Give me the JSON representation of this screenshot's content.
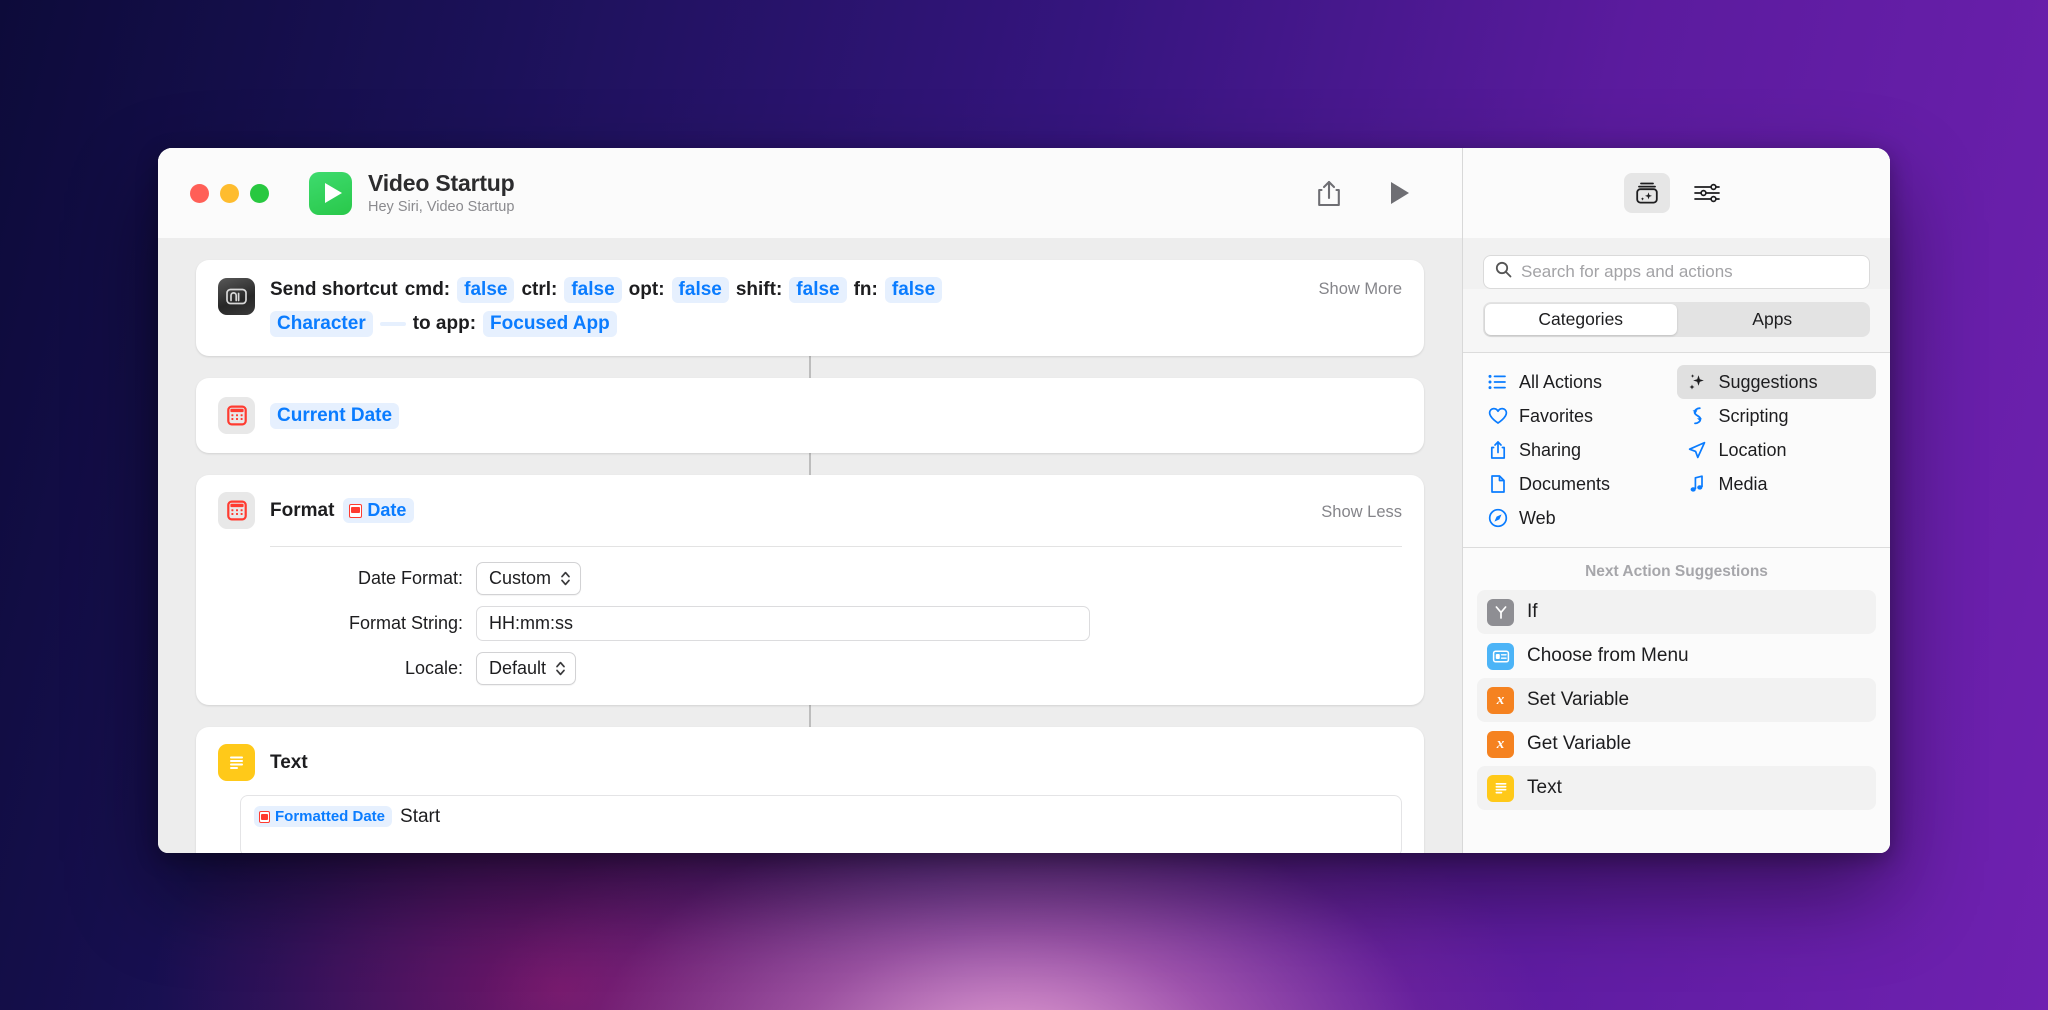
{
  "window": {
    "title": "Video Startup",
    "subtitle": "Hey Siri, Video Startup",
    "traffic_lights": {
      "close": "close",
      "minimize": "minimize",
      "zoom": "zoom"
    },
    "toolbar": {
      "share": "share-icon",
      "run": "play-icon"
    },
    "accent_blue": "#0a7cff",
    "app_icon_color": "#29c84a"
  },
  "flow": {
    "actions": [
      {
        "id": "send-shortcut",
        "icon": "keyboard-icon",
        "prefix": "Send shortcut",
        "toggle_label": "Show More",
        "parts": [
          {
            "kind": "label",
            "text": "cmd:"
          },
          {
            "kind": "token",
            "text": "false"
          },
          {
            "kind": "label",
            "text": "ctrl:"
          },
          {
            "kind": "token",
            "text": "false"
          },
          {
            "kind": "label",
            "text": "opt:"
          },
          {
            "kind": "token",
            "text": "false"
          },
          {
            "kind": "label",
            "text": "shift:"
          },
          {
            "kind": "token",
            "text": "false"
          },
          {
            "kind": "label",
            "text": "fn:"
          },
          {
            "kind": "token",
            "text": "false"
          },
          {
            "kind": "token",
            "text": "Character"
          },
          {
            "kind": "token-empty",
            "text": ""
          },
          {
            "kind": "label",
            "text": "to app:"
          },
          {
            "kind": "token",
            "text": "Focused App"
          }
        ]
      },
      {
        "id": "current-date",
        "icon": "calendar-icon",
        "token": "Current Date"
      },
      {
        "id": "format-date",
        "icon": "calendar-icon",
        "title": "Format",
        "token": "Date",
        "toggle_label": "Show Less",
        "fields": [
          {
            "label": "Date Format:",
            "type": "select",
            "value": "Custom"
          },
          {
            "label": "Format String:",
            "type": "input",
            "value": "HH:mm:ss"
          },
          {
            "label": "Locale:",
            "type": "select",
            "value": "Default"
          }
        ]
      },
      {
        "id": "text",
        "icon": "text-icon",
        "title": "Text",
        "body_token": "Formatted Date",
        "body_text": "Start"
      }
    ]
  },
  "sidebar": {
    "top_buttons": [
      {
        "name": "action-library-icon",
        "active": true
      },
      {
        "name": "sliders-icon",
        "active": false
      }
    ],
    "search": {
      "placeholder": "Search for apps and actions",
      "value": "",
      "icon": "search-icon"
    },
    "segments": [
      {
        "label": "Categories",
        "active": true
      },
      {
        "label": "Apps",
        "active": false
      }
    ],
    "categories_left": [
      {
        "label": "All Actions",
        "icon": "list-icon",
        "active": false
      },
      {
        "label": "Favorites",
        "icon": "heart-icon",
        "active": false
      },
      {
        "label": "Sharing",
        "icon": "share-icon",
        "active": false
      },
      {
        "label": "Documents",
        "icon": "document-icon",
        "active": false
      },
      {
        "label": "Web",
        "icon": "compass-icon",
        "active": false
      }
    ],
    "categories_right": [
      {
        "label": "Suggestions",
        "icon": "sparkles-icon",
        "active": true
      },
      {
        "label": "Scripting",
        "icon": "scripting-icon",
        "active": false
      },
      {
        "label": "Location",
        "icon": "location-icon",
        "active": false
      },
      {
        "label": "Media",
        "icon": "music-note-icon",
        "active": false
      }
    ],
    "suggestions_title": "Next Action Suggestions",
    "suggestions": [
      {
        "label": "If",
        "icon": "if-icon",
        "color": "#8e8e93"
      },
      {
        "label": "Choose from Menu",
        "icon": "menu-icon",
        "color": "#4cb4f7"
      },
      {
        "label": "Set Variable",
        "icon": "variable-icon",
        "color": "#f58220"
      },
      {
        "label": "Get Variable",
        "icon": "variable-icon",
        "color": "#f58220"
      },
      {
        "label": "Text",
        "icon": "text-icon",
        "color": "#ffc919"
      }
    ]
  }
}
